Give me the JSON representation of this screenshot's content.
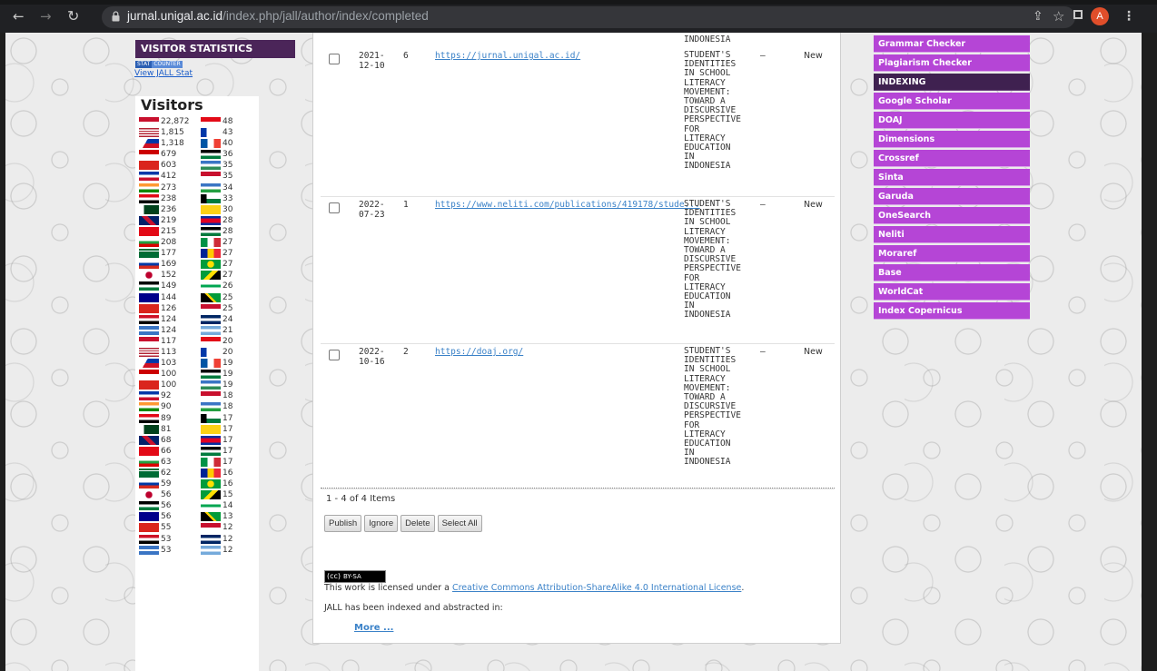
{
  "browser": {
    "url_domain": "jurnal.unigal.ac.id",
    "url_path": "/index.php/jall/author/index/completed",
    "avatar_letter": "A"
  },
  "left": {
    "visitor_statistics_title": "VISITOR STATISTICS",
    "counter_badge": [
      "STAT",
      "COUNTER"
    ],
    "view_stat_link": "View JALL Stat",
    "visitors_title": "Visitors",
    "counts_col1": [
      "22,872",
      "1,815",
      "1,318",
      "679",
      "603",
      "412",
      "273",
      "238",
      "236",
      "219",
      "215",
      "208",
      "177",
      "169",
      "152",
      "149",
      "144",
      "126",
      "124",
      "124",
      "117",
      "113",
      "103",
      "100",
      "100",
      "92",
      "90",
      "89",
      "81",
      "68",
      "66",
      "63",
      "62",
      "59",
      "56",
      "56",
      "56",
      "55",
      "53",
      "53"
    ],
    "counts_col2": [
      "48",
      "43",
      "40",
      "36",
      "35",
      "35",
      "34",
      "33",
      "30",
      "28",
      "28",
      "27",
      "27",
      "27",
      "27",
      "26",
      "25",
      "25",
      "24",
      "21",
      "20",
      "20",
      "19",
      "19",
      "19",
      "18",
      "18",
      "17",
      "17",
      "17",
      "17",
      "17",
      "16",
      "16",
      "15",
      "14",
      "13",
      "12",
      "12",
      "12"
    ]
  },
  "main": {
    "top_fragment": "INDONESIA",
    "rows": [
      {
        "date": "2021-\n12-10",
        "count": "6",
        "url": "https://jurnal.unigal.ac.id/",
        "title": "STUDENT'S\nIDENTITIES\nIN SCHOOL\nLITERACY\nMOVEMENT:\nTOWARD A\nDISCURSIVE\nPERSPECTIVE\nFOR\nLITERACY\nEDUCATION\nIN\nINDONESIA",
        "dash": "—",
        "status": "New"
      },
      {
        "date": "2022-\n07-23",
        "count": "1",
        "url": "https://www.neliti.com/publications/419178/stude...",
        "title": "STUDENT'S\nIDENTITIES\nIN SCHOOL\nLITERACY\nMOVEMENT:\nTOWARD A\nDISCURSIVE\nPERSPECTIVE\nFOR\nLITERACY\nEDUCATION\nIN\nINDONESIA",
        "dash": "—",
        "status": "New"
      },
      {
        "date": "2022-\n10-16",
        "count": "2",
        "url": "https://doaj.org/",
        "title": "STUDENT'S\nIDENTITIES\nIN SCHOOL\nLITERACY\nMOVEMENT:\nTOWARD A\nDISCURSIVE\nPERSPECTIVE\nFOR\nLITERACY\nEDUCATION\nIN\nINDONESIA",
        "dash": "—",
        "status": "New"
      }
    ],
    "items_count": "1 - 4 of 4 Items",
    "buttons": [
      "Publish",
      "Ignore",
      "Delete",
      "Select All"
    ],
    "cc_badge_text": "BY-SA",
    "license_prefix": "This work is licensed under a ",
    "license_link": "Creative Commons Attribution-ShareAlike 4.0 International License",
    "license_suffix": ".",
    "indexed_text": "JALL has been indexed and abstracted in:",
    "more_link": "More ..."
  },
  "right": {
    "tools": [
      "Grammar Checker",
      "Plagiarism Checker"
    ],
    "indexing_header": "INDEXING",
    "indexing_items": [
      "Google Scholar",
      "DOAJ",
      "Dimensions",
      "Crossref",
      "Sinta",
      "Garuda",
      "OneSearch",
      "Neliti",
      "Moraref",
      "Base",
      "WorldCat",
      "Index Copernicus"
    ]
  },
  "colors": {
    "sidebar_purple": "#b545d6",
    "header_dark_purple": "#3f2150",
    "link_blue": "#3b82c8"
  }
}
